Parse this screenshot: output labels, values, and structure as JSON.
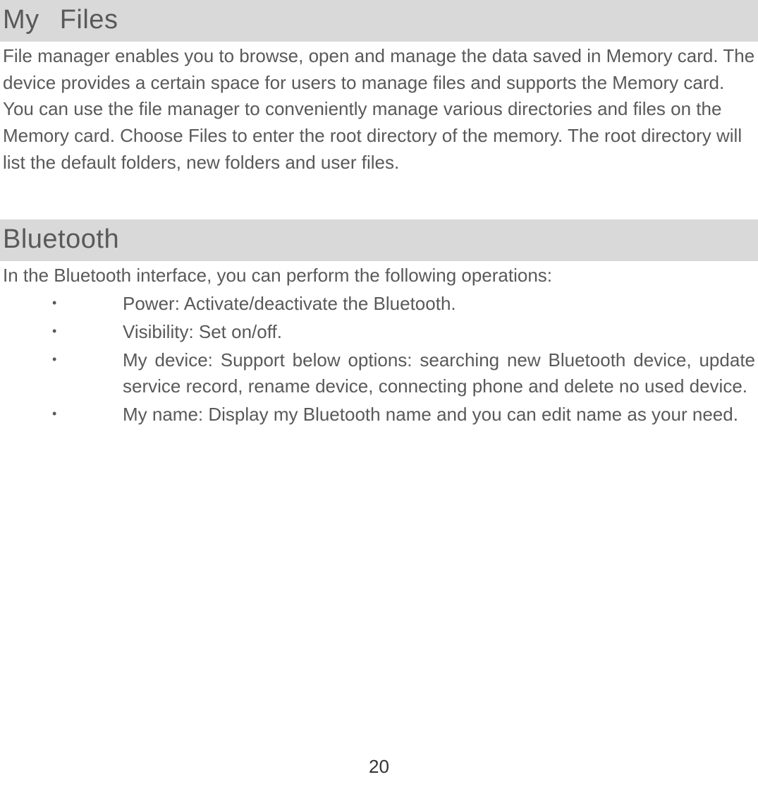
{
  "sections": [
    {
      "title": "My  Files",
      "body": "File manager enables you to browse, open and manage the data saved in Memory card. The device provides a certain space for users to manage files and supports the Memory card. You can use the file manager to conveniently manage various directories and files on the Memory card. Choose Files to enter the root directory of the memory. The root directory will list the default folders, new folders and user files."
    },
    {
      "title": "Bluetooth",
      "body": "In the Bluetooth interface, you can perform the following operations:",
      "bullets": [
        "Power: Activate/deactivate the Bluetooth.",
        "Visibility: Set on/off.",
        "My device: Support below options: searching new Bluetooth device, update service record, rename device, connecting phone and delete no used device.",
        "My name: Display my Bluetooth name and you can edit name as your need."
      ]
    }
  ],
  "pageNumber": "20",
  "bulletChar": "•"
}
